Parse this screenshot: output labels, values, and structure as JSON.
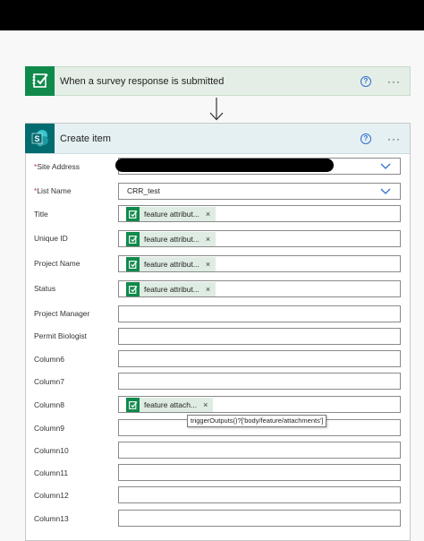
{
  "trigger": {
    "title": "When a survey response is submitted",
    "help": "?",
    "more": "···"
  },
  "action": {
    "title": "Create item",
    "help": "?",
    "more": "···"
  },
  "fields": {
    "site_address": {
      "label": "Site Address",
      "required_mark": "*"
    },
    "list_name": {
      "label": "List Name",
      "required_mark": "*",
      "value": "CRR_test"
    },
    "title": {
      "label": "Title",
      "token": "feature attribut...",
      "remove": "×"
    },
    "unique_id": {
      "label": "Unique ID",
      "token": "feature attribut...",
      "remove": "×"
    },
    "project_name": {
      "label": "Project Name",
      "token": "feature attribut...",
      "remove": "×"
    },
    "status": {
      "label": "Status",
      "token": "feature attribut...",
      "remove": "×"
    },
    "project_manager": {
      "label": "Project Manager"
    },
    "permit_biologist": {
      "label": "Permit Biologist"
    },
    "column6": {
      "label": "Column6"
    },
    "column7": {
      "label": "Column7"
    },
    "column8": {
      "label": "Column8",
      "token": "feature attach...",
      "remove": "×"
    },
    "column9": {
      "label": "Column9"
    },
    "column10": {
      "label": "Column10"
    },
    "column11": {
      "label": "Column11"
    },
    "column12": {
      "label": "Column12"
    },
    "column13": {
      "label": "Column13"
    }
  },
  "tooltip": {
    "text": "triggerOutputs()?['body/feature/attachments']"
  },
  "colors": {
    "forms_green": "#0f8a4b",
    "sharepoint_teal": "#036c70",
    "trigger_bg": "#e4eee6",
    "action_header_bg": "#e5f0f2",
    "token_bg": "#dfece3",
    "link_blue": "#2f6fd3"
  }
}
